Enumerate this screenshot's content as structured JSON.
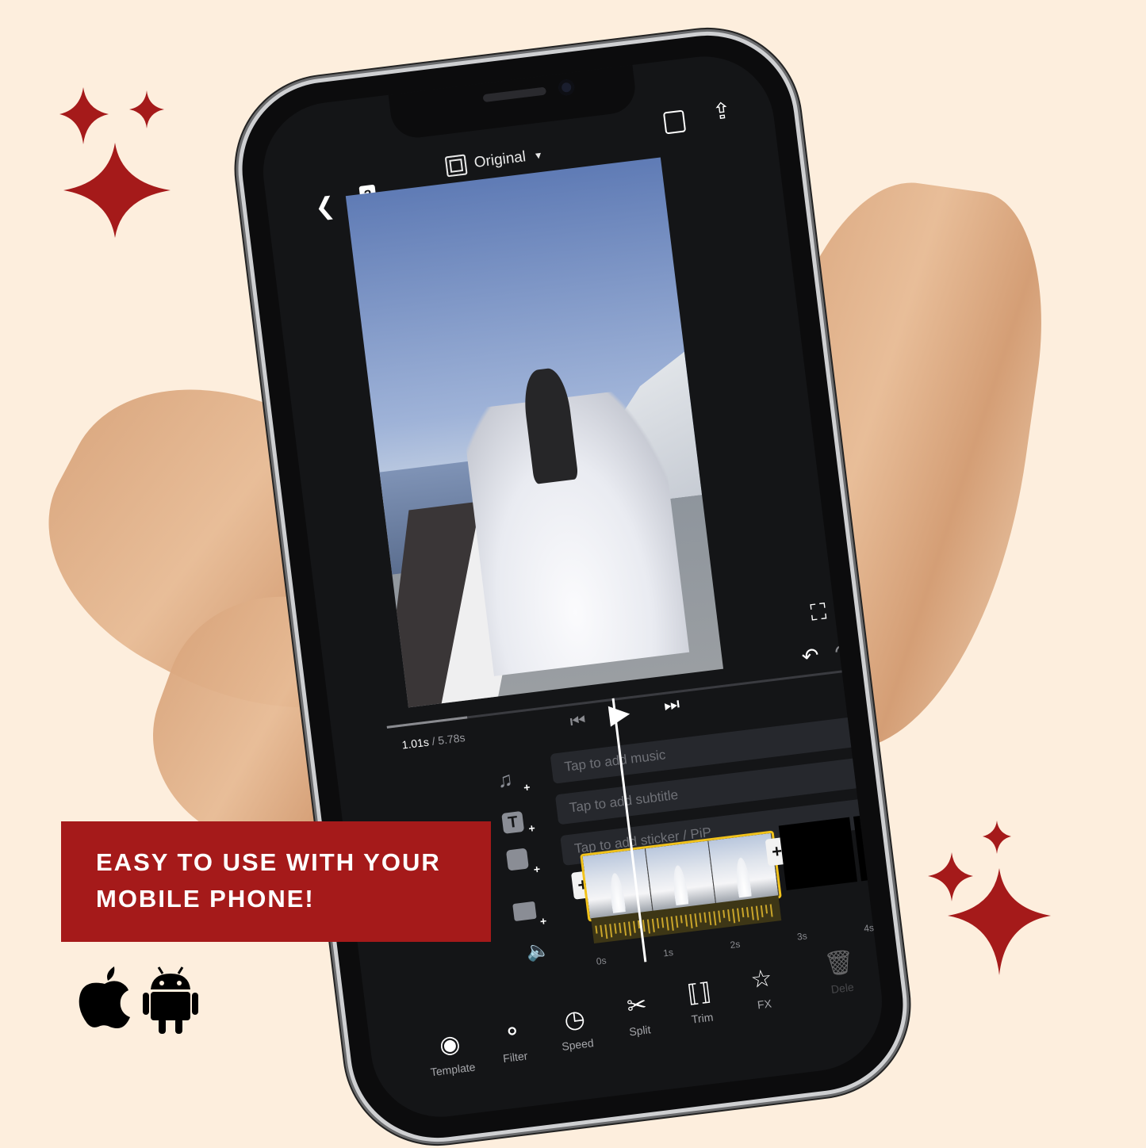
{
  "colors": {
    "background": "#fdeedd",
    "brush_stroke": "#dfae85",
    "accent_red": "#a51a1a",
    "sparkle": "#a51a1a",
    "clip_border": "#f1c21b",
    "app_bg": "#141517"
  },
  "promo": {
    "headline_line1": "EASY TO USE WITH YOUR",
    "headline_line2": "MOBILE PHONE!",
    "platform_icons": [
      "apple-icon",
      "android-icon"
    ]
  },
  "editor": {
    "topbar": {
      "back_icon": "chevron-left-icon",
      "help_icon": "help-book-icon",
      "aspect_label": "Original",
      "aspect_dropdown_icon": "caret-down-icon",
      "save_icon": "floppy-disk-icon",
      "export_icon": "share-upload-icon"
    },
    "preview": {
      "expand_icon": "fullscreen-icon",
      "undo_icon": "undo-icon",
      "redo_icon": "redo-icon"
    },
    "playback": {
      "current_time": "1.01s",
      "separator": " / ",
      "total_time": "5.78s",
      "progress_fraction": 0.17,
      "prev_icon": "skip-previous-icon",
      "play_icon": "play-icon",
      "next_icon": "skip-next-icon"
    },
    "tracks": [
      {
        "icon": "music-add-icon",
        "placeholder": "Tap to add music"
      },
      {
        "icon": "text-add-icon",
        "placeholder": "Tap to add subtitle"
      },
      {
        "icon": "sticker-add-icon",
        "placeholder": "Tap to add sticker / PiP"
      }
    ],
    "video_track": {
      "icon": "video-add-icon",
      "add_left": "+",
      "add_right": "+",
      "clip_count": 3,
      "volume_icon": "volume-icon"
    },
    "ruler": [
      "0s",
      "1s",
      "2s",
      "3s",
      "4s"
    ],
    "toolbar": [
      {
        "icon": "template-icon",
        "label": "Template"
      },
      {
        "icon": "filter-icon",
        "label": "Filter"
      },
      {
        "icon": "speed-icon",
        "label": "Speed"
      },
      {
        "icon": "scissors-icon",
        "label": "Split"
      },
      {
        "icon": "trim-icon",
        "label": "Trim"
      },
      {
        "icon": "fx-star-icon",
        "label": "FX"
      },
      {
        "icon": "trash-icon",
        "label": "Dele"
      }
    ]
  }
}
